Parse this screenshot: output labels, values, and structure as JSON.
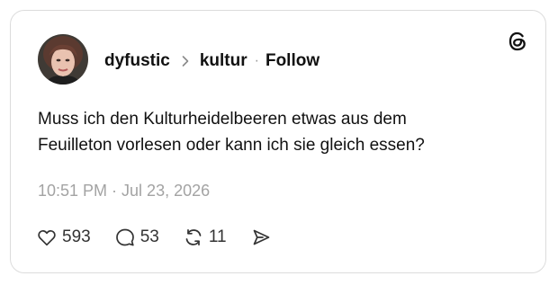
{
  "post": {
    "author": "dyfustic",
    "community": "kultur",
    "follow_label": "Follow",
    "separator": "·",
    "text_lines": [
      "Muss ich den Kulturheidelbeeren etwas aus dem",
      "Feuilleton vorlesen oder kann ich sie gleich essen?"
    ],
    "timestamp": "10:51 PM · Jul 23, 2026",
    "likes": "593",
    "replies": "53",
    "reposts": "11"
  },
  "icons": {
    "brand": "threads-logo-icon",
    "like": "heart-icon",
    "reply": "speech-bubble-icon",
    "repost": "repost-arrows-icon",
    "share": "send-icon",
    "breadcrumb": "chevron-right-icon"
  },
  "colors": {
    "text": "#111111",
    "muted": "#a3a3a3",
    "border": "#dcdcdc"
  }
}
